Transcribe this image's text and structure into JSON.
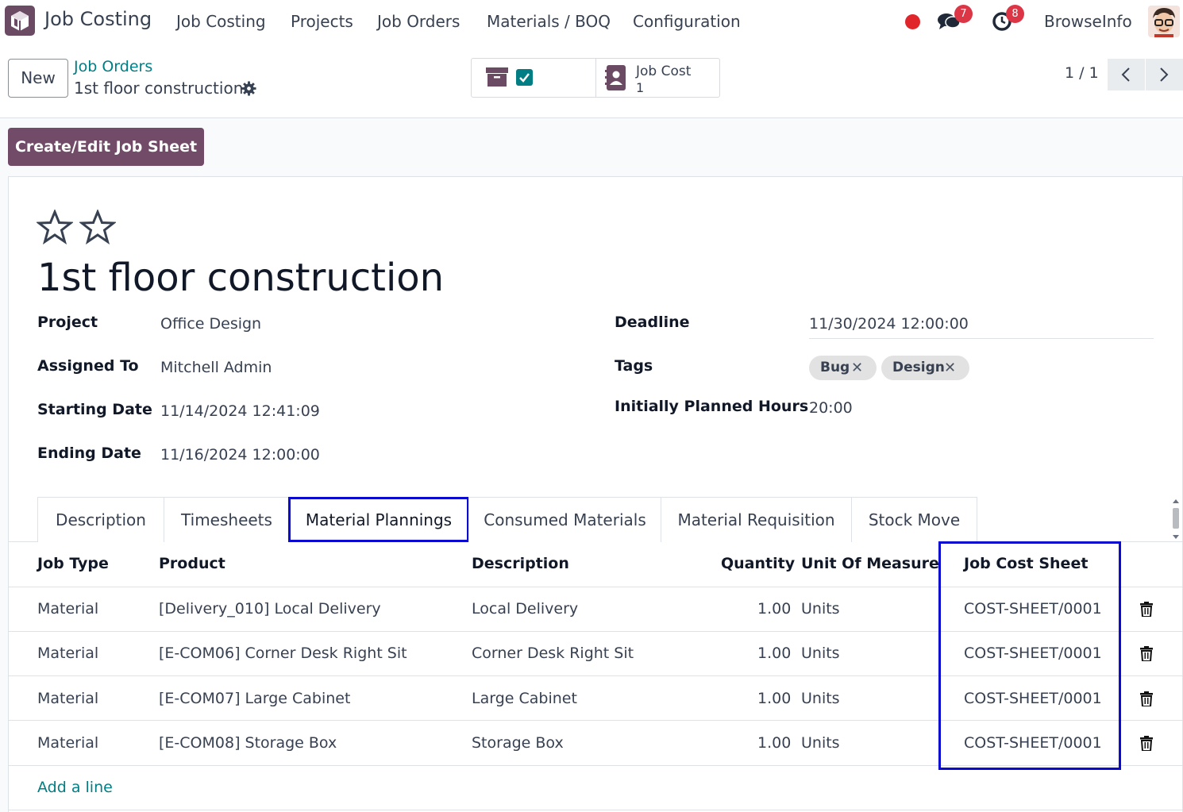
{
  "navbar": {
    "app_name": "Job Costing",
    "menu": [
      "Job Costing",
      "Projects",
      "Job Orders",
      "Materials / BOQ",
      "Configuration"
    ],
    "messages_count": "7",
    "activities_count": "8",
    "company": "BrowseInfo",
    "icons": {
      "app": "cube-app-icon",
      "messages": "chat-bubbles-icon",
      "activities": "clock-icon"
    }
  },
  "control": {
    "new_label": "New",
    "breadcrumb_parent": "Job Orders",
    "breadcrumb_current": "1st floor construction",
    "smart_button_label": "Job Cost",
    "smart_button_value": "1",
    "pager": "1 / 1"
  },
  "actions": {
    "create_edit_job_sheet": "Create/Edit Job Sheet"
  },
  "record": {
    "title": "1st floor construction",
    "fields": {
      "project_label": "Project",
      "project": "Office Design",
      "assigned_label": "Assigned To",
      "assigned": "Mitchell Admin",
      "start_label": "Starting Date",
      "start": "11/14/2024 12:41:09",
      "end_label": "Ending Date",
      "end": "11/16/2024 12:00:00",
      "deadline_label": "Deadline",
      "deadline": "11/30/2024 12:00:00",
      "tags_label": "Tags",
      "planned_label": "Initially Planned Hours",
      "planned": "20:00"
    },
    "tags": [
      "Bug",
      "Design"
    ]
  },
  "tabs": [
    "Description",
    "Timesheets",
    "Material Plannings",
    "Consumed Materials",
    "Material Requisition",
    "Stock Move"
  ],
  "active_tab": "Material Plannings",
  "table": {
    "headers": [
      "Job Type",
      "Product",
      "Description",
      "Quantity",
      "Unit Of Measure",
      "Job Cost Sheet"
    ],
    "rows": [
      [
        "Material",
        "[Delivery_010] Local Delivery",
        "Local Delivery",
        "1.00",
        "Units",
        "COST-SHEET/0001"
      ],
      [
        "Material",
        "[E-COM06] Corner Desk Right Sit",
        "Corner Desk Right Sit",
        "1.00",
        "Units",
        "COST-SHEET/0001"
      ],
      [
        "Material",
        "[E-COM07] Large Cabinet",
        "Large Cabinet",
        "1.00",
        "Units",
        "COST-SHEET/0001"
      ],
      [
        "Material",
        "[E-COM08] Storage Box",
        "Storage Box",
        "1.00",
        "Units",
        "COST-SHEET/0001"
      ]
    ],
    "add_line": "Add a line"
  },
  "colors": {
    "brand": "#714b67",
    "link": "#017e84",
    "highlight": "#0a0ad0",
    "badge": "#dc3545"
  }
}
